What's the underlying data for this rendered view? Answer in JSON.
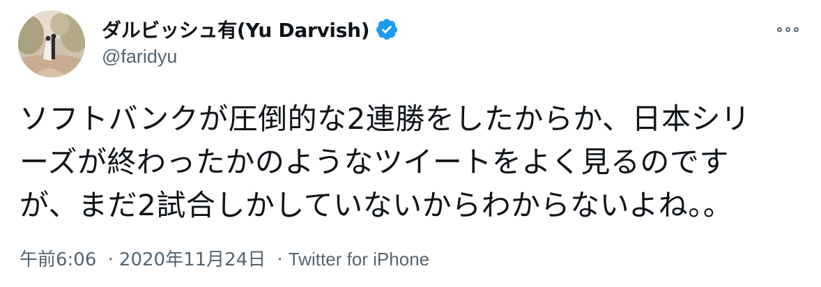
{
  "tweet": {
    "display_name": "ダルビッシュ有(Yu Darvish)",
    "handle": "@faridyu",
    "verified_icon": "verified-badge-icon",
    "more_icon": "more-options-icon",
    "text_lines": [
      "ソフトバンクが圧倒的な2連勝をしたからか、日本シリ",
      "ーズが終わったかのようなツイートをよく見るのです",
      "が、まだ2試合しかしていないからわからないよね。。"
    ],
    "time": "午前6:06",
    "date": "2020年11月24日",
    "separator": "·",
    "source": "Twitter for iPhone"
  },
  "colors": {
    "verified": "#1d9bf0",
    "secondary_text": "#536471",
    "primary_text": "#0f1419"
  }
}
